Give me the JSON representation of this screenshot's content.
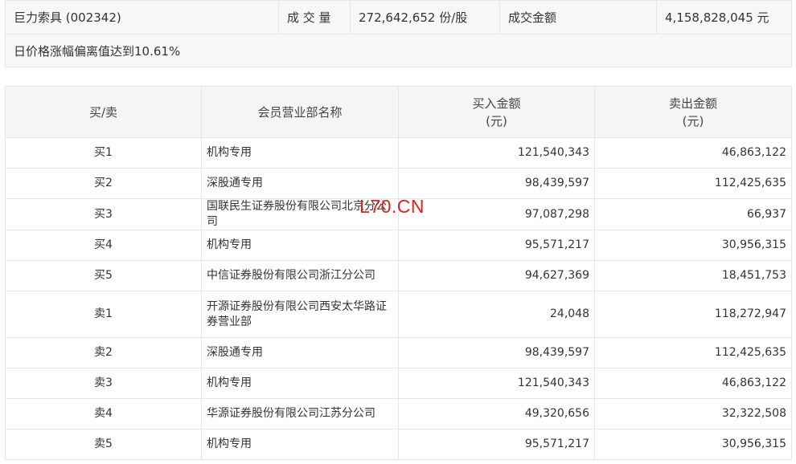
{
  "summary": {
    "stock": "巨力索具 (002342)",
    "volume_label": "成 交 量",
    "volume_value": "272,642,652 份/股",
    "amount_label": "成交金额",
    "amount_value": "4,158,828,045 元",
    "reason": "日价格涨幅偏离值达到10.61%"
  },
  "table": {
    "headers": {
      "side": "买/卖",
      "name": "会员营业部名称",
      "buy_l1": "买入金额",
      "buy_l2": "(元)",
      "sell_l1": "卖出金额",
      "sell_l2": "(元)"
    },
    "rows": [
      {
        "side": "买1",
        "name": "机构专用",
        "buy": "121,540,343",
        "sell": "46,863,122"
      },
      {
        "side": "买2",
        "name": "深股通专用",
        "buy": "98,439,597",
        "sell": "112,425,635"
      },
      {
        "side": "买3",
        "name": "国联民生证券股份有限公司北京分公司",
        "buy": "97,087,298",
        "sell": "66,937"
      },
      {
        "side": "买4",
        "name": "机构专用",
        "buy": "95,571,217",
        "sell": "30,956,315"
      },
      {
        "side": "买5",
        "name": "中信证券股份有限公司浙江分公司",
        "buy": "94,627,369",
        "sell": "18,451,753"
      },
      {
        "side": "卖1",
        "name": "开源证券股份有限公司西安太华路证券营业部",
        "buy": "24,048",
        "sell": "118,272,947"
      },
      {
        "side": "卖2",
        "name": "深股通专用",
        "buy": "98,439,597",
        "sell": "112,425,635"
      },
      {
        "side": "卖3",
        "name": "机构专用",
        "buy": "121,540,343",
        "sell": "46,863,122"
      },
      {
        "side": "卖4",
        "name": "华源证券股份有限公司江苏分公司",
        "buy": "49,320,656",
        "sell": "32,322,508"
      },
      {
        "side": "卖5",
        "name": "机构专用",
        "buy": "95,571,217",
        "sell": "30,956,315"
      }
    ]
  },
  "watermark": "L70.CN"
}
